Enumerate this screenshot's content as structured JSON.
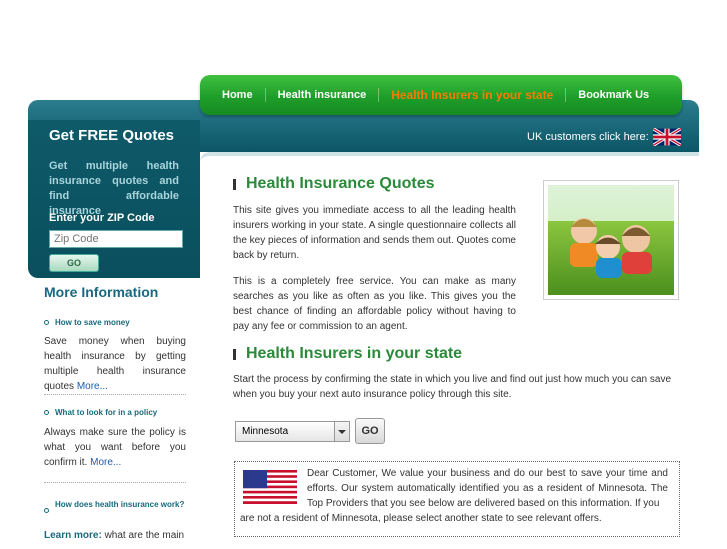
{
  "nav": {
    "items": [
      "Home",
      "Health insurance",
      "Health Insurers in your state",
      "Bookmark Us"
    ]
  },
  "banner": {
    "uk_text": "UK customers click here:"
  },
  "sidebar": {
    "get_title": "Get FREE Quotes",
    "get_desc": "Get multiple health insurance quotes and find affordable insurance",
    "zip_label": "Enter your ZIP Code",
    "zip_placeholder": "Zip Code",
    "go_label": "GO",
    "more_title": "More Information",
    "q1": "How to save money",
    "p1": "Save money when buying health insurance by getting multiple health insurance quotes",
    "q2": "What to look for in a policy",
    "p2": "Always make sure the policy is what you want before you confirm it.",
    "more_link": "More...",
    "q3": "How does health insurance work?",
    "p3_strong": "Learn more:",
    "p3": " what are the main"
  },
  "main": {
    "title1": "Health Insurance Quotes",
    "para1": "This site gives you immediate access to all the leading health insurers working in your state. A single questionnaire collects all the key pieces of information and sends them out. Quotes come back by return.",
    "para2": "This is a completely free service. You can make as many searches as you like as often as you like. This gives you the best chance of finding an affordable policy without having to pay any fee or commission to an agent.",
    "title2": "Health Insurers in your state",
    "para3": "Start the process by confirming the state in which you live and find out just how much you can save when you buy your next auto insurance policy through this site.",
    "state_value": "Minnesota",
    "go_label": "GO",
    "notice1": "Dear Customer, We value your business and do our best to save your time and efforts. Our system automatically identified you as a resident of Minnesota. The Top Providers that you see below are delivered based on this information. If you",
    "notice2": "are not a resident of Minnesota, please select another state to see relevant offers."
  },
  "colors": {
    "green": "#2a8a3a",
    "teal": "#0b5566",
    "orange": "#f57c00"
  }
}
